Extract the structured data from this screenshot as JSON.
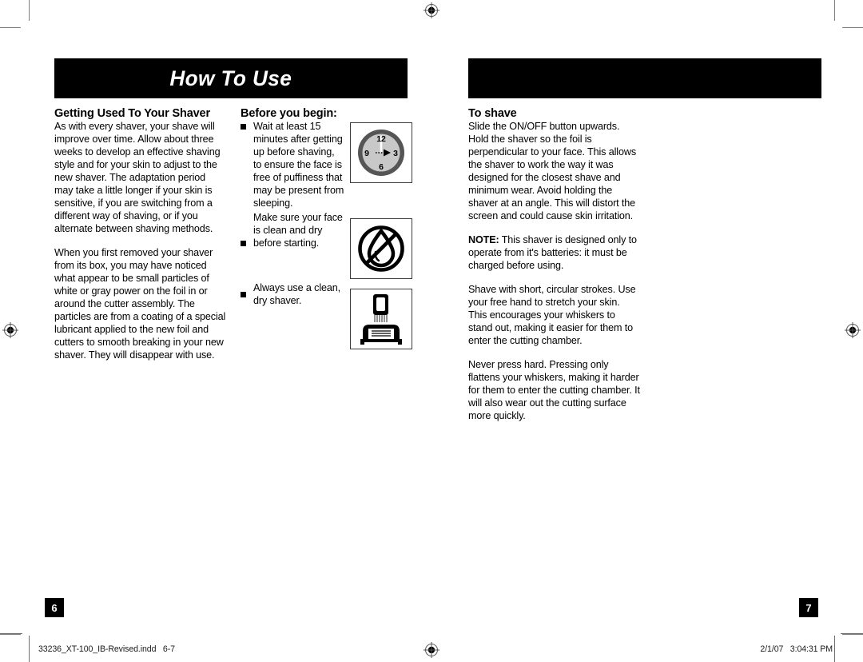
{
  "document": {
    "left_page": {
      "banner_title": "How To Use",
      "section1": {
        "heading": "Getting Used To Your Shaver",
        "paragraph1": "As with every shaver, your shave will improve over time. Allow about three weeks to develop an effective shaving style and for your skin to adjust to the new shaver. The adaptation period may take a little longer if your skin is sensitive, if you are switching from a different way of shaving, or if you alternate between shaving methods.",
        "paragraph2": "When you first removed your shaver from its box, you may have noticed what appear to be small particles of white or gray power on the foil in or around the cutter assembly. The particles are from a coating of a special lubricant applied to the new foil and cutters to smooth breaking in your new shaver. They will disappear with use."
      },
      "section2": {
        "heading": "Before you begin:",
        "bullets": [
          {
            "text": "Wait at least 15 minutes after getting up before shaving, to ensure the face is free of puffiness that may be present from sleeping.",
            "icon": "clock-icon"
          },
          {
            "text": "Make sure your face is clean and dry before starting.",
            "icon": "no-water-icon"
          },
          {
            "text": "Always use a clean, dry shaver.",
            "icon": "shaver-on-stand-icon"
          }
        ]
      },
      "page_number": "6"
    },
    "right_page": {
      "banner_title": "",
      "section1": {
        "heading": "To shave",
        "paragraph1": "Slide the ON/OFF button upwards. Hold the shaver so the foil is perpendicular to your face. This allows the shaver to work the way it was designed for the closest shave and minimum wear. Avoid holding the shaver at an angle. This will distort the screen and could cause skin irritation.",
        "note_lead": "NOTE:",
        "note_body": " This shaver is designed only to operate from it's batteries: it must be charged before using.",
        "paragraph3": "Shave with short, circular strokes. Use your free hand to stretch your skin. This encourages your whiskers to stand out, making it easier for them to enter the cutting chamber.",
        "paragraph4": "Never press hard. Pressing only flattens your whiskers, making it harder for them to enter the cutting chamber. It will also wear out the cutting surface more quickly."
      },
      "page_number": "7"
    },
    "footer": {
      "filename": "33236_XT-100_IB-Revised.indd   6-7",
      "timestamp": "2/1/07   3:04:31 PM"
    },
    "clock_icon": {
      "label_12": "12",
      "label_3": "3",
      "label_6": "6",
      "label_9": "9"
    },
    "colors": {
      "banner_background": "#000000",
      "banner_text": "#ffffff",
      "body_text": "#000000",
      "icon_frame": "#3c3c3c",
      "clock_rim": "#555555",
      "clock_face": "#c8c8c8",
      "footer_rule": "#6e6e6e"
    }
  }
}
